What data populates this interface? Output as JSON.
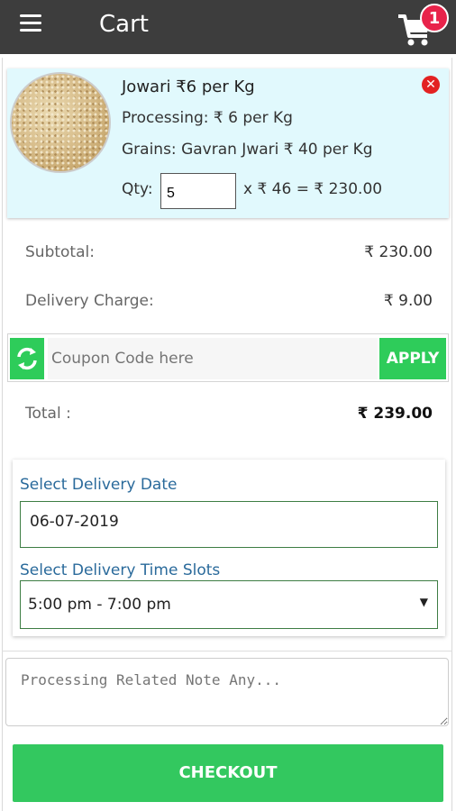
{
  "header": {
    "title": "Cart",
    "cart_count": "1"
  },
  "item": {
    "name": "Jowari ₹6 per Kg",
    "processing": "Processing: ₹ 6 per Kg",
    "grains": "Grains: Gavran Jwari ₹ 40 per Kg",
    "qty_label": "Qty:",
    "qty_value": "5",
    "calc": "x ₹ 46 = ₹ 230.00"
  },
  "summary": {
    "subtotal_label": "Subtotal:",
    "subtotal_value": "₹ 230.00",
    "delivery_label": "Delivery Charge:",
    "delivery_value": "₹ 9.00",
    "total_label": "Total :",
    "total_value": "₹ 239.00"
  },
  "coupon": {
    "placeholder": "Coupon Code here",
    "apply_label": "APPLY"
  },
  "delivery": {
    "date_label": "Select Delivery Date",
    "date_value": "06-07-2019",
    "slot_label": "Select Delivery Time Slots",
    "slot_value": "5:00 pm - 7:00 pm"
  },
  "note": {
    "placeholder": "Processing Related Note Any..."
  },
  "checkout_label": "CHECKOUT",
  "colors": {
    "header_bg": "#3d3d3d",
    "accent_green": "#33c85f",
    "badge_red": "#e8234a",
    "item_bg": "#e1f9fd",
    "label_blue": "#2a6a9b"
  }
}
